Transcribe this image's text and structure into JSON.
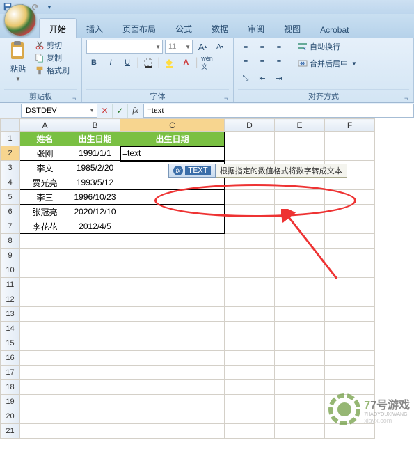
{
  "qat": {
    "save": "save",
    "undo": "undo",
    "redo": "redo"
  },
  "tabs": {
    "items": [
      "开始",
      "插入",
      "页面布局",
      "公式",
      "数据",
      "审阅",
      "视图",
      "Acrobat"
    ],
    "active_index": 0
  },
  "ribbon": {
    "clipboard": {
      "label": "剪贴板",
      "paste": "粘贴",
      "cut": "剪切",
      "copy": "复制",
      "format_painter": "格式刷"
    },
    "font": {
      "label": "字体",
      "family_placeholder": "",
      "size": "11",
      "bold": "B",
      "italic": "I",
      "underline": "U",
      "increase": "A",
      "decrease": "A"
    },
    "align": {
      "label": "对齐方式",
      "wrap": "自动换行",
      "merge": "合并后居中"
    }
  },
  "formula_bar": {
    "name_box": "DSTDEV",
    "formula": "=text"
  },
  "columns": [
    "A",
    "B",
    "C",
    "D",
    "E",
    "F"
  ],
  "headers": {
    "name": "姓名",
    "dob1": "出生日期",
    "dob2": "出生日期"
  },
  "rows": [
    {
      "name": "张刚",
      "dob": "1991/1/1",
      "c": "=text"
    },
    {
      "name": "李文",
      "dob": "1985/2/20",
      "c": ""
    },
    {
      "name": "贾光亮",
      "dob": "1993/5/12",
      "c": ""
    },
    {
      "name": "李三",
      "dob": "1996/10/23",
      "c": ""
    },
    {
      "name": "张冠亮",
      "dob": "2020/12/10",
      "c": ""
    },
    {
      "name": "李花花",
      "dob": "2012/4/5",
      "c": ""
    }
  ],
  "tooltip": {
    "fn": "TEXT",
    "desc": "根据指定的数值格式将数字转成文本"
  },
  "watermark": {
    "brand": "7号游戏",
    "sub": "7HAOYOUXIWANG",
    "url": "xiayx.com"
  },
  "active_cell": {
    "row": 2,
    "col": "C"
  }
}
